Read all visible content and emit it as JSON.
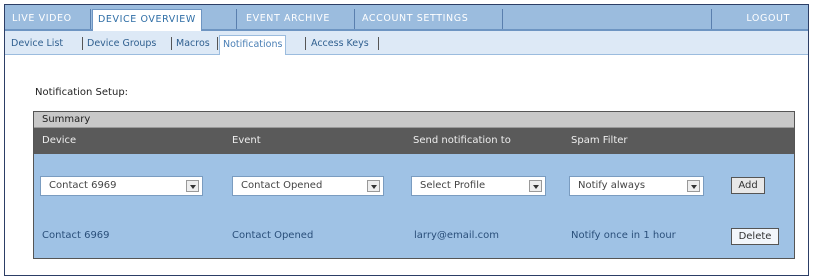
{
  "nav": {
    "tabs": [
      "LIVE VIDEO",
      "DEVICE OVERVIEW",
      "EVENT ARCHIVE",
      "ACCOUNT SETTINGS"
    ],
    "active_tab": "DEVICE OVERVIEW",
    "logout_label": "LOGOUT"
  },
  "subnav": {
    "items": [
      "Device List",
      "Device Groups",
      "Macros",
      "Notifications",
      "Access Keys"
    ],
    "active": "Notifications"
  },
  "section_title": "Notification Setup:",
  "panel": {
    "title": "Summary",
    "columns": [
      "Device",
      "Event",
      "Send notification to",
      "Spam Filter"
    ],
    "form": {
      "device_value": "Contact 6969",
      "event_value": "Contact Opened",
      "send_to_value": "Select Profile",
      "spam_value": "Notify always",
      "add_label": "Add"
    },
    "rows": [
      {
        "device": "Contact 6969",
        "event": "Contact Opened",
        "send_to": "larry@email.com",
        "spam": "Notify once in 1 hour",
        "delete_label": "Delete"
      }
    ]
  }
}
